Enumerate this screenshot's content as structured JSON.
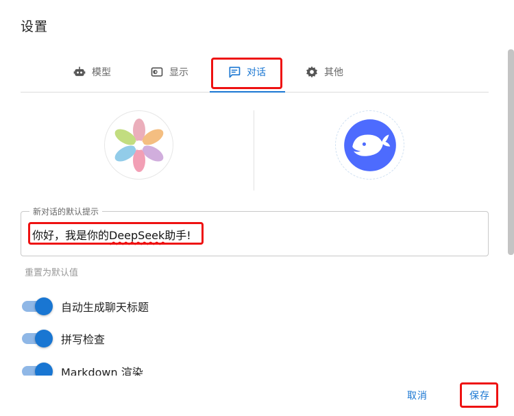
{
  "dialog": {
    "title": "设置"
  },
  "tabs": [
    {
      "label": "模型",
      "icon": "robot-icon"
    },
    {
      "label": "显示",
      "icon": "display-icon"
    },
    {
      "label": "对话",
      "icon": "chat-icon",
      "active": true
    },
    {
      "label": "其他",
      "icon": "gear-icon"
    }
  ],
  "avatars": {
    "user": {
      "icon": "user-avatar-art"
    },
    "assistant": {
      "icon": "deepseek-whale-icon"
    }
  },
  "prompt_field": {
    "label": "新对话的默认提示",
    "value_prefix": "你好，我是你的",
    "value_misspelled": "DeepSeek",
    "value_suffix": "助手!"
  },
  "reset_label": "重置为默认值",
  "toggles": [
    {
      "label": "自动生成聊天标题",
      "on": true
    },
    {
      "label": "拼写检查",
      "on": true
    },
    {
      "label": "Markdown 渲染",
      "on": true
    }
  ],
  "footer": {
    "cancel_label": "取消",
    "save_label": "保存"
  },
  "colors": {
    "accent": "#1976d2",
    "highlight": "#ee1111",
    "whale": "#4d6bfe"
  }
}
